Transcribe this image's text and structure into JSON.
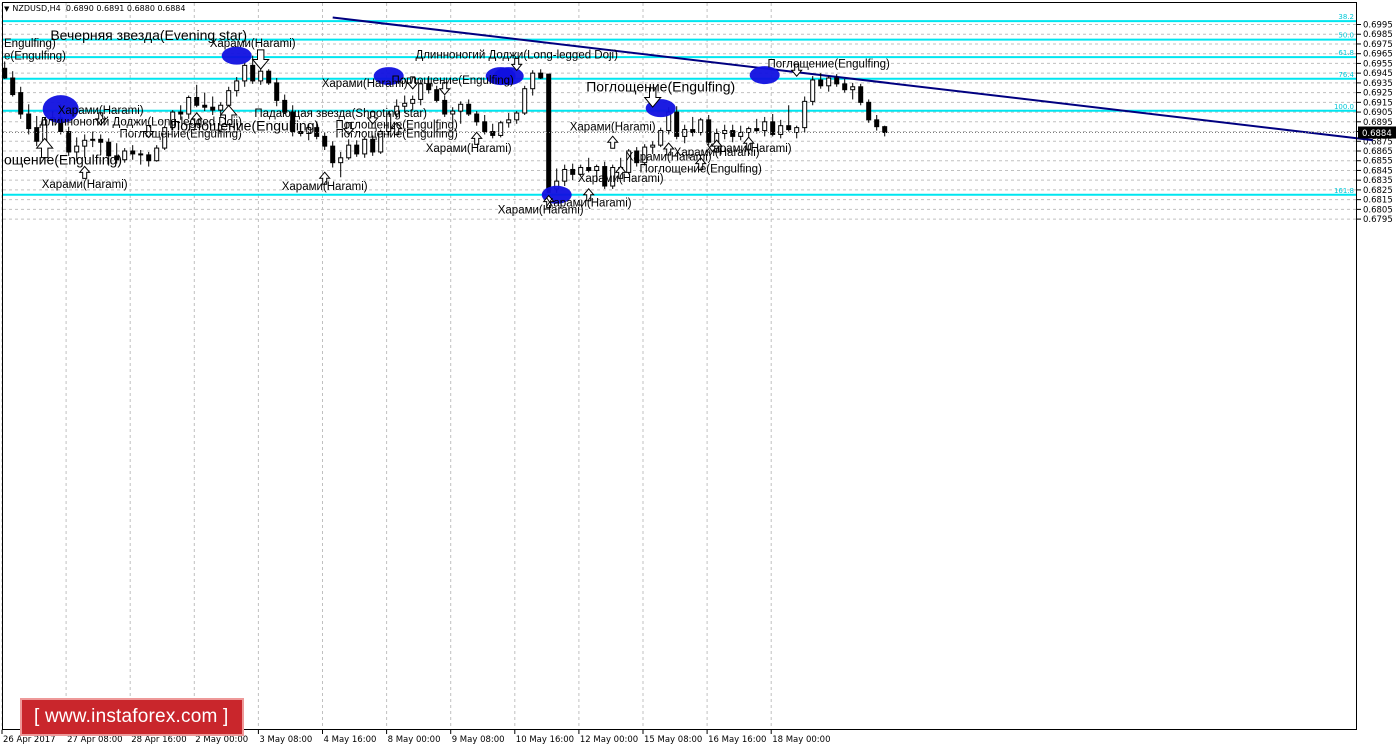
{
  "header": {
    "symbol": "NZDUSD,H4",
    "ohlc": "0.6890 0.6891 0.6880 0.6884"
  },
  "watermark": "[ www.instaforex.com ]",
  "colors": {
    "background": "#ffffff",
    "grid": "#c0c0c0",
    "fib_line": "#00e6f0",
    "fib_label": "#00c8d8",
    "trend_line": "#000080",
    "candle": "#000000",
    "marker": "#1010e0"
  },
  "chart_data": {
    "type": "candlestick",
    "symbol": "NZDUSD",
    "timeframe": "H4",
    "current_price": "0.6884",
    "ylim": [
      0.679,
      0.7
    ],
    "y_ticks": [
      "0.6995",
      "0.6985",
      "0.6975",
      "0.6965",
      "0.6955",
      "0.6945",
      "0.6935",
      "0.6925",
      "0.6915",
      "0.6905",
      "0.6895",
      "0.6885",
      "0.6875",
      "0.6865",
      "0.6855",
      "0.6845",
      "0.6835",
      "0.6825",
      "0.6815",
      "0.6805",
      "0.6795"
    ],
    "x_tick_labels": [
      "26 Apr 2017",
      "27 Apr 08:00",
      "28 Apr 16:00",
      "2 May 00:00",
      "3 May 08:00",
      "4 May 16:00",
      "8 May 00:00",
      "9 May 08:00",
      "10 May 16:00",
      "12 May 00:00",
      "15 May 08:00",
      "16 May 16:00",
      "18 May 00:00"
    ],
    "fib_levels": [
      {
        "label": "38.2",
        "price": 0.69985
      },
      {
        "label": "50.0",
        "price": 0.69795
      },
      {
        "label": "61.8",
        "price": 0.69615
      },
      {
        "label": "76.4",
        "price": 0.69392
      },
      {
        "label": "100.0",
        "price": 0.69063
      },
      {
        "label": "161.8",
        "price": 0.682
      }
    ],
    "trend_line": {
      "from": {
        "bar": 41,
        "price": 0.70022
      },
      "to": {
        "bar": 171,
        "price": 0.68762
      }
    },
    "candles": [
      {
        "o": 0.695,
        "h": 0.6957,
        "l": 0.6939,
        "c": 0.694
      },
      {
        "o": 0.694,
        "h": 0.6947,
        "l": 0.6921,
        "c": 0.6923
      },
      {
        "o": 0.6925,
        "h": 0.6931,
        "l": 0.6898,
        "c": 0.6903
      },
      {
        "o": 0.6903,
        "h": 0.6913,
        "l": 0.6882,
        "c": 0.6888
      },
      {
        "o": 0.6889,
        "h": 0.6901,
        "l": 0.687,
        "c": 0.6875
      },
      {
        "o": 0.6875,
        "h": 0.6899,
        "l": 0.6871,
        "c": 0.6897
      },
      {
        "o": 0.6897,
        "h": 0.6906,
        "l": 0.6891,
        "c": 0.6899
      },
      {
        "o": 0.6899,
        "h": 0.6913,
        "l": 0.6882,
        "c": 0.6885
      },
      {
        "o": 0.6885,
        "h": 0.689,
        "l": 0.686,
        "c": 0.6864
      },
      {
        "o": 0.6864,
        "h": 0.6879,
        "l": 0.6855,
        "c": 0.687
      },
      {
        "o": 0.687,
        "h": 0.6882,
        "l": 0.6858,
        "c": 0.6876
      },
      {
        "o": 0.6876,
        "h": 0.6885,
        "l": 0.6869,
        "c": 0.6877
      },
      {
        "o": 0.6877,
        "h": 0.6882,
        "l": 0.6861,
        "c": 0.6874
      },
      {
        "o": 0.6874,
        "h": 0.6878,
        "l": 0.685,
        "c": 0.686
      },
      {
        "o": 0.686,
        "h": 0.6873,
        "l": 0.6852,
        "c": 0.6856
      },
      {
        "o": 0.6856,
        "h": 0.6868,
        "l": 0.6853,
        "c": 0.6865
      },
      {
        "o": 0.6865,
        "h": 0.6871,
        "l": 0.6856,
        "c": 0.6862
      },
      {
        "o": 0.6862,
        "h": 0.6866,
        "l": 0.6851,
        "c": 0.6861
      },
      {
        "o": 0.6861,
        "h": 0.6864,
        "l": 0.6849,
        "c": 0.6855
      },
      {
        "o": 0.6855,
        "h": 0.6871,
        "l": 0.6854,
        "c": 0.6868
      },
      {
        "o": 0.6868,
        "h": 0.6891,
        "l": 0.6866,
        "c": 0.6889
      },
      {
        "o": 0.6889,
        "h": 0.6907,
        "l": 0.6886,
        "c": 0.6905
      },
      {
        "o": 0.6905,
        "h": 0.6912,
        "l": 0.6897,
        "c": 0.6903
      },
      {
        "o": 0.6903,
        "h": 0.6922,
        "l": 0.6898,
        "c": 0.692
      },
      {
        "o": 0.692,
        "h": 0.6933,
        "l": 0.691,
        "c": 0.6912
      },
      {
        "o": 0.6912,
        "h": 0.6925,
        "l": 0.6906,
        "c": 0.691
      },
      {
        "o": 0.691,
        "h": 0.6921,
        "l": 0.6902,
        "c": 0.6907
      },
      {
        "o": 0.6907,
        "h": 0.6915,
        "l": 0.69,
        "c": 0.6912
      },
      {
        "o": 0.6912,
        "h": 0.6931,
        "l": 0.6905,
        "c": 0.6927
      },
      {
        "o": 0.6927,
        "h": 0.6941,
        "l": 0.6921,
        "c": 0.6937
      },
      {
        "o": 0.6937,
        "h": 0.6956,
        "l": 0.6931,
        "c": 0.6953
      },
      {
        "o": 0.6953,
        "h": 0.6963,
        "l": 0.6934,
        "c": 0.6937
      },
      {
        "o": 0.6937,
        "h": 0.695,
        "l": 0.6933,
        "c": 0.6947
      },
      {
        "o": 0.6947,
        "h": 0.6949,
        "l": 0.6933,
        "c": 0.6935
      },
      {
        "o": 0.6935,
        "h": 0.694,
        "l": 0.6911,
        "c": 0.6917
      },
      {
        "o": 0.6917,
        "h": 0.6923,
        "l": 0.6903,
        "c": 0.6905
      },
      {
        "o": 0.6905,
        "h": 0.6912,
        "l": 0.688,
        "c": 0.6885
      },
      {
        "o": 0.6885,
        "h": 0.6891,
        "l": 0.688,
        "c": 0.6883
      },
      {
        "o": 0.6883,
        "h": 0.6893,
        "l": 0.6876,
        "c": 0.6889
      },
      {
        "o": 0.6889,
        "h": 0.6895,
        "l": 0.6877,
        "c": 0.688
      },
      {
        "o": 0.688,
        "h": 0.6884,
        "l": 0.6866,
        "c": 0.687
      },
      {
        "o": 0.687,
        "h": 0.6875,
        "l": 0.6848,
        "c": 0.6853
      },
      {
        "o": 0.6853,
        "h": 0.6864,
        "l": 0.6838,
        "c": 0.6858
      },
      {
        "o": 0.6858,
        "h": 0.6877,
        "l": 0.6856,
        "c": 0.6871
      },
      {
        "o": 0.6871,
        "h": 0.6876,
        "l": 0.6859,
        "c": 0.6862
      },
      {
        "o": 0.6862,
        "h": 0.6879,
        "l": 0.6858,
        "c": 0.6877
      },
      {
        "o": 0.6877,
        "h": 0.6881,
        "l": 0.686,
        "c": 0.6864
      },
      {
        "o": 0.6864,
        "h": 0.6887,
        "l": 0.6862,
        "c": 0.6885
      },
      {
        "o": 0.6885,
        "h": 0.6906,
        "l": 0.6881,
        "c": 0.6903
      },
      {
        "o": 0.6903,
        "h": 0.6918,
        "l": 0.6899,
        "c": 0.6911
      },
      {
        "o": 0.6911,
        "h": 0.6922,
        "l": 0.6904,
        "c": 0.6914
      },
      {
        "o": 0.6914,
        "h": 0.6922,
        "l": 0.6907,
        "c": 0.6918
      },
      {
        "o": 0.6918,
        "h": 0.6938,
        "l": 0.6912,
        "c": 0.6934
      },
      {
        "o": 0.6934,
        "h": 0.6942,
        "l": 0.6924,
        "c": 0.6928
      },
      {
        "o": 0.6928,
        "h": 0.6932,
        "l": 0.6915,
        "c": 0.6917
      },
      {
        "o": 0.6917,
        "h": 0.6922,
        "l": 0.69,
        "c": 0.6903
      },
      {
        "o": 0.6903,
        "h": 0.691,
        "l": 0.6894,
        "c": 0.6906
      },
      {
        "o": 0.6906,
        "h": 0.6916,
        "l": 0.6893,
        "c": 0.6913
      },
      {
        "o": 0.6913,
        "h": 0.6918,
        "l": 0.6901,
        "c": 0.6903
      },
      {
        "o": 0.6903,
        "h": 0.6906,
        "l": 0.6891,
        "c": 0.6895
      },
      {
        "o": 0.6895,
        "h": 0.6902,
        "l": 0.6882,
        "c": 0.6885
      },
      {
        "o": 0.6885,
        "h": 0.6893,
        "l": 0.6878,
        "c": 0.6881
      },
      {
        "o": 0.6881,
        "h": 0.6896,
        "l": 0.6879,
        "c": 0.6894
      },
      {
        "o": 0.6894,
        "h": 0.6904,
        "l": 0.6889,
        "c": 0.6897
      },
      {
        "o": 0.6897,
        "h": 0.6906,
        "l": 0.6893,
        "c": 0.6904
      },
      {
        "o": 0.6904,
        "h": 0.6932,
        "l": 0.6902,
        "c": 0.6929
      },
      {
        "o": 0.6929,
        "h": 0.6948,
        "l": 0.6922,
        "c": 0.6945
      },
      {
        "o": 0.6945,
        "h": 0.6949,
        "l": 0.6939,
        "c": 0.694
      },
      {
        "o": 0.6944,
        "h": 0.6944,
        "l": 0.6822,
        "c": 0.6826
      },
      {
        "o": 0.6826,
        "h": 0.6847,
        "l": 0.6822,
        "c": 0.6834
      },
      {
        "o": 0.6834,
        "h": 0.6851,
        "l": 0.6829,
        "c": 0.6846
      },
      {
        "o": 0.6846,
        "h": 0.6852,
        "l": 0.6835,
        "c": 0.6841
      },
      {
        "o": 0.6841,
        "h": 0.6851,
        "l": 0.684,
        "c": 0.6848
      },
      {
        "o": 0.6848,
        "h": 0.6858,
        "l": 0.6843,
        "c": 0.6845
      },
      {
        "o": 0.6845,
        "h": 0.6851,
        "l": 0.6833,
        "c": 0.6849
      },
      {
        "o": 0.6849,
        "h": 0.6854,
        "l": 0.6826,
        "c": 0.6829
      },
      {
        "o": 0.6829,
        "h": 0.6851,
        "l": 0.6826,
        "c": 0.6848
      },
      {
        "o": 0.6848,
        "h": 0.6858,
        "l": 0.6839,
        "c": 0.6843
      },
      {
        "o": 0.6843,
        "h": 0.6867,
        "l": 0.6841,
        "c": 0.6865
      },
      {
        "o": 0.6865,
        "h": 0.6869,
        "l": 0.6849,
        "c": 0.6853
      },
      {
        "o": 0.6853,
        "h": 0.6872,
        "l": 0.685,
        "c": 0.6869
      },
      {
        "o": 0.6869,
        "h": 0.6875,
        "l": 0.6862,
        "c": 0.6871
      },
      {
        "o": 0.6871,
        "h": 0.6889,
        "l": 0.6869,
        "c": 0.6886
      },
      {
        "o": 0.6886,
        "h": 0.691,
        "l": 0.6882,
        "c": 0.6905
      },
      {
        "o": 0.6905,
        "h": 0.6911,
        "l": 0.6877,
        "c": 0.688
      },
      {
        "o": 0.688,
        "h": 0.6892,
        "l": 0.6873,
        "c": 0.6887
      },
      {
        "o": 0.6887,
        "h": 0.69,
        "l": 0.688,
        "c": 0.6884
      },
      {
        "o": 0.6884,
        "h": 0.6899,
        "l": 0.6881,
        "c": 0.6897
      },
      {
        "o": 0.6897,
        "h": 0.6902,
        "l": 0.6871,
        "c": 0.6874
      },
      {
        "o": 0.6874,
        "h": 0.6888,
        "l": 0.687,
        "c": 0.6883
      },
      {
        "o": 0.6883,
        "h": 0.6892,
        "l": 0.6877,
        "c": 0.6886
      },
      {
        "o": 0.6886,
        "h": 0.6892,
        "l": 0.6874,
        "c": 0.688
      },
      {
        "o": 0.688,
        "h": 0.6891,
        "l": 0.6876,
        "c": 0.6884
      },
      {
        "o": 0.6884,
        "h": 0.689,
        "l": 0.6878,
        "c": 0.6888
      },
      {
        "o": 0.6888,
        "h": 0.6898,
        "l": 0.6883,
        "c": 0.6886
      },
      {
        "o": 0.6886,
        "h": 0.69,
        "l": 0.688,
        "c": 0.6895
      },
      {
        "o": 0.6895,
        "h": 0.6903,
        "l": 0.688,
        "c": 0.6882
      },
      {
        "o": 0.6882,
        "h": 0.6897,
        "l": 0.6878,
        "c": 0.6891
      },
      {
        "o": 0.6891,
        "h": 0.6912,
        "l": 0.6885,
        "c": 0.6887
      },
      {
        "o": 0.6884,
        "h": 0.6891,
        "l": 0.6878,
        "c": 0.6889
      },
      {
        "o": 0.6889,
        "h": 0.6921,
        "l": 0.6884,
        "c": 0.6916
      },
      {
        "o": 0.6916,
        "h": 0.6942,
        "l": 0.6912,
        "c": 0.6938
      },
      {
        "o": 0.6938,
        "h": 0.6945,
        "l": 0.6929,
        "c": 0.6932
      },
      {
        "o": 0.6932,
        "h": 0.6942,
        "l": 0.6926,
        "c": 0.694
      },
      {
        "o": 0.694,
        "h": 0.6944,
        "l": 0.6931,
        "c": 0.6934
      },
      {
        "o": 0.6934,
        "h": 0.6939,
        "l": 0.6925,
        "c": 0.6928
      },
      {
        "o": 0.6928,
        "h": 0.6935,
        "l": 0.6918,
        "c": 0.6931
      },
      {
        "o": 0.6931,
        "h": 0.6934,
        "l": 0.6912,
        "c": 0.6915
      },
      {
        "o": 0.6915,
        "h": 0.6918,
        "l": 0.6894,
        "c": 0.6897
      },
      {
        "o": 0.6897,
        "h": 0.6902,
        "l": 0.6886,
        "c": 0.689
      },
      {
        "o": 0.689,
        "h": 0.6891,
        "l": 0.688,
        "c": 0.6884
      }
    ],
    "ellipses": [
      {
        "bar": 7,
        "price": 0.6908
      },
      {
        "bar": 29,
        "price": 0.6963
      },
      {
        "bar": 48,
        "price": 0.6942
      },
      {
        "bar": 62,
        "price": 0.6942
      },
      {
        "bar": 63,
        "price": 0.6942
      },
      {
        "bar": 69,
        "price": 0.682
      },
      {
        "bar": 82,
        "price": 0.6909
      },
      {
        "bar": 95,
        "price": 0.6943
      }
    ],
    "arrows": [
      {
        "bar": 5,
        "price": 0.6868,
        "dir": "up",
        "big": true
      },
      {
        "bar": 10,
        "price": 0.6843,
        "dir": "up"
      },
      {
        "bar": 12,
        "price": 0.6898,
        "dir": "down"
      },
      {
        "bar": 18,
        "price": 0.6885,
        "dir": "down"
      },
      {
        "bar": 24,
        "price": 0.6898,
        "dir": "up"
      },
      {
        "bar": 28,
        "price": 0.6902,
        "dir": "up",
        "big": true
      },
      {
        "bar": 32,
        "price": 0.6959,
        "dir": "down",
        "big": true
      },
      {
        "bar": 40,
        "price": 0.6837,
        "dir": "up"
      },
      {
        "bar": 43,
        "price": 0.6888,
        "dir": "down"
      },
      {
        "bar": 46,
        "price": 0.6899,
        "dir": "down"
      },
      {
        "bar": 49,
        "price": 0.6888,
        "dir": "up"
      },
      {
        "bar": 51,
        "price": 0.6935,
        "dir": "down"
      },
      {
        "bar": 55,
        "price": 0.6929,
        "dir": "down"
      },
      {
        "bar": 59,
        "price": 0.6878,
        "dir": "up"
      },
      {
        "bar": 64,
        "price": 0.6954,
        "dir": "down"
      },
      {
        "bar": 68,
        "price": 0.6813,
        "dir": "up"
      },
      {
        "bar": 73,
        "price": 0.682,
        "dir": "up"
      },
      {
        "bar": 76,
        "price": 0.6874,
        "dir": "up"
      },
      {
        "bar": 77,
        "price": 0.6843,
        "dir": "up"
      },
      {
        "bar": 81,
        "price": 0.692,
        "dir": "down",
        "big": true
      },
      {
        "bar": 83,
        "price": 0.6867,
        "dir": "up"
      },
      {
        "bar": 87,
        "price": 0.6852,
        "dir": "up"
      },
      {
        "bar": 89,
        "price": 0.687,
        "dir": "up"
      },
      {
        "bar": 93,
        "price": 0.6873,
        "dir": "up"
      },
      {
        "bar": 99,
        "price": 0.6948,
        "dir": "down"
      }
    ],
    "annotations": [
      {
        "text": "Вечерняя звезда(Evening star)",
        "bar": 18,
        "price": 0.6979,
        "big": true
      },
      {
        "text": "Харами(Harami)",
        "bar": 31,
        "price": 0.6972
      },
      {
        "text": "Длинноногий Доджи(Long-legged Doji)",
        "bar": 64,
        "price": 0.696
      },
      {
        "text": "Поглощение(Engulfing)",
        "bar": 103,
        "price": 0.6951
      },
      {
        "text": "Поглощение(Engulfing)",
        "bar": 56,
        "price": 0.6934
      },
      {
        "text": "Харами(Harami)",
        "bar": 45,
        "price": 0.6931
      },
      {
        "text": "Поглощение(Engulfing)",
        "bar": 82,
        "price": 0.6926,
        "big": true
      },
      {
        "text": "Харами(Harami)",
        "bar": 12,
        "price": 0.6903
      },
      {
        "text": "Падающая звезда(Shooting star)",
        "bar": 42,
        "price": 0.69
      },
      {
        "text": "Длинноногий Доджи(Long-legged Doji)",
        "bar": 17,
        "price": 0.6891
      },
      {
        "text": "Поглощение(Engulfing)",
        "bar": 49,
        "price": 0.6888
      },
      {
        "text": "Поглощение(Engulfing)",
        "bar": 30,
        "price": 0.6886,
        "big": true
      },
      {
        "text": "Харами(Harami)",
        "bar": 76,
        "price": 0.6886
      },
      {
        "text": "Поглощение(Engulfing)",
        "bar": 22,
        "price": 0.6879
      },
      {
        "text": "Поглощение(Engulfing)",
        "bar": 49,
        "price": 0.6879
      },
      {
        "text": "Харами(Harami)",
        "bar": 58,
        "price": 0.6864
      },
      {
        "text": "Харами(Harami)",
        "bar": 93,
        "price": 0.6864
      },
      {
        "text": "Харами(Harami)",
        "bar": 89,
        "price": 0.686
      },
      {
        "text": "Харами(Harami)",
        "bar": 83,
        "price": 0.6855
      },
      {
        "text": "Поглощение(Engulfing)",
        "bar": 87,
        "price": 0.6843
      },
      {
        "text": "Харами(Harami)",
        "bar": 77,
        "price": 0.6833
      },
      {
        "text": "Харами(Harami)",
        "bar": 10,
        "price": 0.6827
      },
      {
        "text": "Харами(Harami)",
        "bar": 40,
        "price": 0.6825
      },
      {
        "text": "Харами(Harami)",
        "bar": 73,
        "price": 0.6808
      },
      {
        "text": "Харами(Harami)",
        "bar": 67,
        "price": 0.6801
      }
    ],
    "edge_labels": [
      {
        "text": "Engulfing)",
        "price": 0.6972,
        "align": "left"
      },
      {
        "text": "e(Engulfing)",
        "price": 0.6959,
        "align": "left"
      },
      {
        "text": "ощение(Engulfing)",
        "price": 0.6851,
        "align": "left",
        "big": true
      }
    ]
  }
}
